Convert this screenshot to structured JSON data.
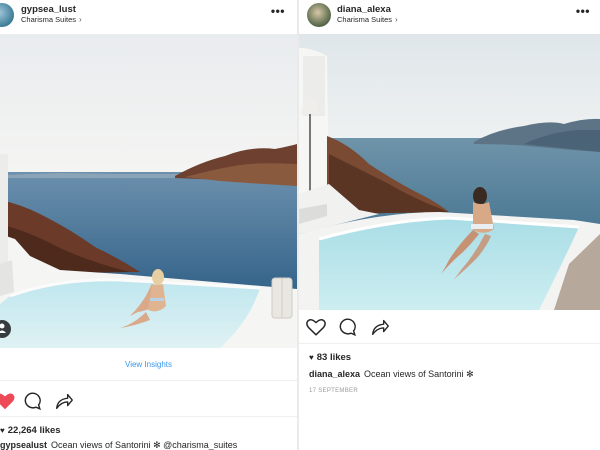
{
  "posts": [
    {
      "username": "gypsea_lust",
      "location": "Charisma Suites",
      "more": "•••",
      "photo": "woman sitting in infinity pool overlooking Santorini caldera",
      "insights_link": "View Insights",
      "likes": "22,264 likes",
      "caption_user": "gypsealust",
      "caption_text": "Ocean views of Santorini ✻ @charisma_suites",
      "liked": true,
      "colors": {
        "like_red": "#ed4956",
        "link_blue": "#3897f0"
      }
    },
    {
      "username": "diana_alexa",
      "location": "Charisma Suites",
      "more": "•••",
      "photo": "woman in infinity pool with Santorini caldera view",
      "likes": "83 likes",
      "caption_user": "diana_alexa",
      "caption_text": "Ocean views of Santorini ✻",
      "timestamp": "17 SEPTEMBER",
      "liked": false
    }
  ],
  "icons": {
    "heart": "heart-icon",
    "comment": "comment-icon",
    "share": "share-icon",
    "more": "more-options-icon",
    "chevron": "chevron-right-icon",
    "user_tag": "user-tag-icon"
  }
}
